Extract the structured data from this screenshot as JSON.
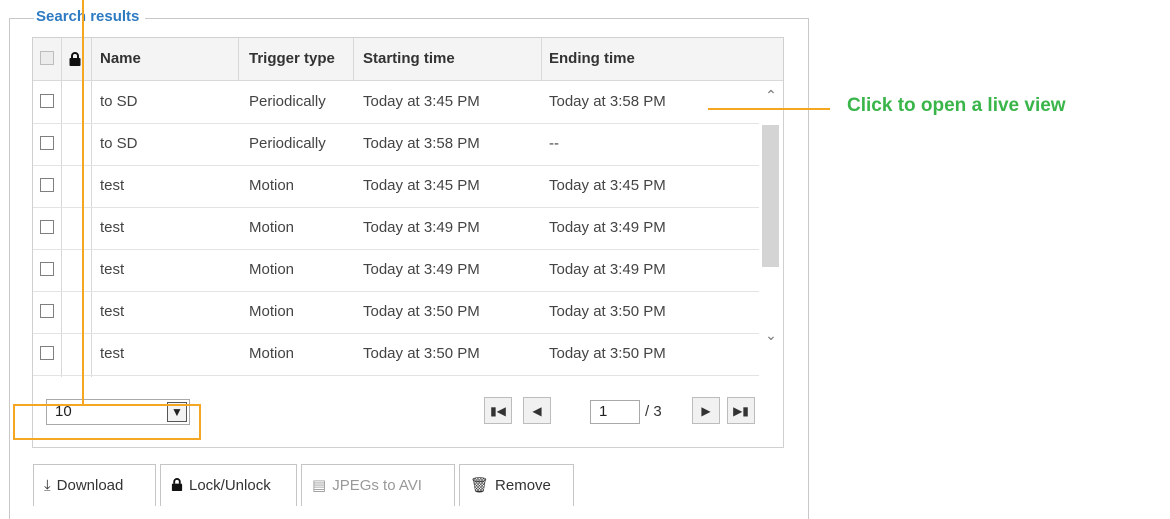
{
  "group_title": "Search results",
  "columns": [
    "Name",
    "Trigger type",
    "Starting time",
    "Ending time"
  ],
  "rows": [
    {
      "name": "to SD",
      "trigger": "Periodically",
      "start": "Today at 3:45 PM",
      "end": "Today at 3:58 PM"
    },
    {
      "name": "to SD",
      "trigger": "Periodically",
      "start": "Today at 3:58 PM",
      "end": "--"
    },
    {
      "name": "test",
      "trigger": "Motion",
      "start": "Today at 3:45 PM",
      "end": "Today at 3:45 PM"
    },
    {
      "name": "test",
      "trigger": "Motion",
      "start": "Today at 3:49 PM",
      "end": "Today at 3:49 PM"
    },
    {
      "name": "test",
      "trigger": "Motion",
      "start": "Today at 3:49 PM",
      "end": "Today at 3:49 PM"
    },
    {
      "name": "test",
      "trigger": "Motion",
      "start": "Today at 3:50 PM",
      "end": "Today at 3:50 PM"
    },
    {
      "name": "test",
      "trigger": "Motion",
      "start": "Today at 3:50 PM",
      "end": "Today at 3:50 PM"
    }
  ],
  "pager": {
    "per_page": "10",
    "current_page": "1",
    "total_label": "/ 3"
  },
  "actions": {
    "download": "Download",
    "lock": "Lock/Unlock",
    "jpegs": "JPEGs to AVI",
    "remove": "Remove"
  },
  "annotation": {
    "text": "Click to open a live view",
    "color": "#3ab54a",
    "line_color": "#f5a623"
  },
  "icons": {
    "lock": "lock-icon",
    "download": "download-icon",
    "film": "film-icon",
    "trash": "trash-icon",
    "first": "first-page-icon",
    "prev": "prev-page-icon",
    "next": "next-page-icon",
    "last": "last-page-icon"
  },
  "colors": {
    "legend": "#2e7bc2",
    "border": "#d0d0d0"
  }
}
